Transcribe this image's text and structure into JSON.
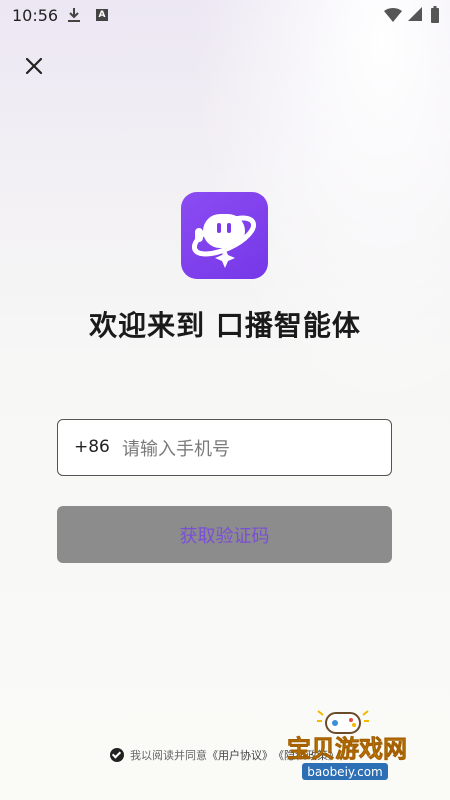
{
  "status_bar": {
    "time": "10:56",
    "a_badge": "A"
  },
  "logo_text": "",
  "welcome_title": "欢迎来到 口播智能体",
  "phone": {
    "country_code": "+86",
    "placeholder": "请输入手机号",
    "value": ""
  },
  "get_code_label": "获取验证码",
  "agreement": {
    "prefix": "我以阅读并同意",
    "user_agreement": "《用户协议》",
    "privacy_policy": "《隐私政策》"
  },
  "watermark": {
    "title": "宝贝游戏网",
    "url": "baobeiy.com"
  },
  "colors": {
    "brand": "#7c3aed",
    "button_disabled": "#8c8c8c",
    "button_text": "#7a4fd6"
  }
}
